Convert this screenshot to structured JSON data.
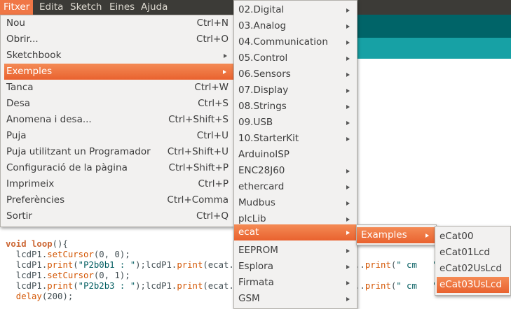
{
  "menubar": [
    "Fitxer",
    "Edita",
    "Sketch",
    "Eines",
    "Ajuda"
  ],
  "file_menu": [
    {
      "label": "Nou",
      "shortcut": "Ctrl+N"
    },
    {
      "label": "Obrir...",
      "shortcut": "Ctrl+O"
    },
    {
      "label": "Sketchbook",
      "shortcut": ""
    },
    {
      "label": "Exemples",
      "shortcut": ""
    },
    {
      "label": "Tanca",
      "shortcut": "Ctrl+W"
    },
    {
      "label": "Desa",
      "shortcut": "Ctrl+S"
    },
    {
      "label": "Anomena i desa...",
      "shortcut": "Ctrl+Shift+S"
    },
    {
      "label": "Puja",
      "shortcut": "Ctrl+U"
    },
    {
      "label": "Puja utilitzant un Programador",
      "shortcut": "Ctrl+Shift+U"
    },
    {
      "label": "Configuració de la pàgina",
      "shortcut": "Ctrl+Shift+P"
    },
    {
      "label": "Imprimeix",
      "shortcut": "Ctrl+P"
    },
    {
      "label": "Preferències",
      "shortcut": "Ctrl+Comma"
    },
    {
      "label": "Sortir",
      "shortcut": "Ctrl+Q"
    }
  ],
  "examples_menu": [
    "02.Digital",
    "03.Analog",
    "04.Communication",
    "05.Control",
    "06.Sensors",
    "07.Display",
    "08.Strings",
    "09.USB",
    "10.StarterKit",
    "ArduinoISP",
    "ENC28J60",
    "ethercard",
    "Mudbus",
    "plcLib",
    "ecat",
    "EEPROM",
    "Esplora",
    "Firmata",
    "GSM"
  ],
  "ecat_menu": [
    "Examples"
  ],
  "ecat_examples_menu": [
    "eCat00",
    "eCat01Lcd",
    "eCat02UsLcd",
    "eCat03UsLcd"
  ],
  "code": {
    "l1_kw": "void",
    "l1_fn": "loop",
    "l1_rest": "(){",
    "l2_obj": "  lcdP1.",
    "l2_fn": "setCursor",
    "l2_rest": "(0, 0);",
    "l3_obj": "  lcdP1.",
    "l3_fn": "print",
    "l3_str": "\"P2b0b1 : \"",
    "l3_rest": ";lcdP1.",
    "l3_fn2": "print",
    "l3_tail": "(ecat.nU",
    "l3_right_a": "..",
    "l3_right_fn": "print",
    "l3_right_str": "\" cm   \"",
    "l4_obj": "  lcdP1.",
    "l4_fn": "setCursor",
    "l4_rest": "(0, 1);",
    "l5_obj": "  lcdP1.",
    "l5_fn": "print",
    "l5_str": "\"P2b2b3 : \"",
    "l5_rest": ";lcdP1.",
    "l5_fn2": "print",
    "l5_tail": "(ecat.nU",
    "l5_right_a": "..",
    "l5_right_fn": "print",
    "l5_right_str": "\" cm   \"",
    "l6_fn": "  delay",
    "l6_rest": "(200);"
  }
}
